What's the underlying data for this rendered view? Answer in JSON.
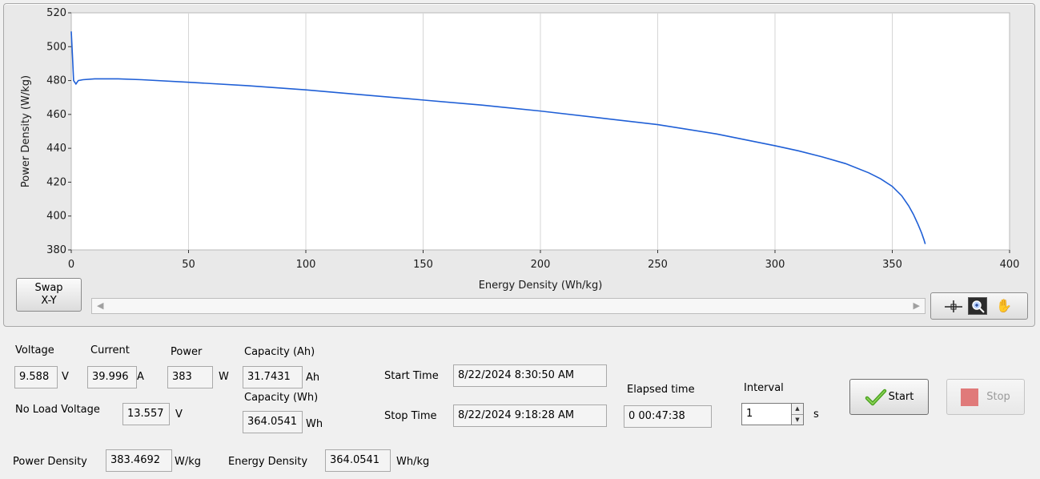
{
  "chart_data": {
    "type": "line",
    "xlabel": "Energy Density (Wh/kg)",
    "ylabel": "Power Density (W/kg)",
    "xlim": [
      0,
      400
    ],
    "ylim": [
      380,
      520
    ],
    "xticks": [
      0,
      50,
      100,
      150,
      200,
      250,
      300,
      350,
      400
    ],
    "yticks": [
      380,
      400,
      420,
      440,
      460,
      480,
      500,
      520
    ],
    "grid": "x-only",
    "line_color": "#1f5fd6",
    "series": [
      {
        "x": [
          0,
          0.5,
          1,
          2,
          3,
          5,
          10,
          20,
          30,
          50,
          75,
          100,
          125,
          150,
          175,
          200,
          225,
          250,
          275,
          300,
          310,
          320,
          330,
          340,
          345,
          350,
          354,
          357,
          359,
          361,
          362.5,
          363.5,
          364.05
        ],
        "y": [
          509,
          495,
          480,
          478,
          480,
          480.5,
          481,
          481,
          480.5,
          479,
          477,
          474.5,
          471.5,
          468.5,
          465.5,
          462,
          458,
          454,
          448.5,
          441.5,
          438.5,
          435,
          431,
          425.5,
          422,
          417.5,
          412,
          406,
          401,
          395,
          390,
          386,
          383.5
        ]
      }
    ]
  },
  "graph": {
    "swap_label_line1": "Swap",
    "swap_label_line2": "X-Y"
  },
  "readouts": {
    "voltage_label": "Voltage",
    "voltage_value": "9.588",
    "voltage_unit": "V",
    "current_label": "Current",
    "current_value": "39.996",
    "current_unit": "A",
    "power_label": "Power",
    "power_value": "383",
    "power_unit": "W",
    "capacity_ah_label": "Capacity (Ah)",
    "capacity_ah_value": "31.7431",
    "capacity_ah_unit": "Ah",
    "capacity_wh_label": "Capacity (Wh)",
    "capacity_wh_value": "364.0541",
    "capacity_wh_unit": "Wh",
    "noload_label": "No Load Voltage",
    "noload_value": "13.557",
    "noload_unit": "V",
    "power_density_label": "Power Density",
    "power_density_value": "383.4692",
    "power_density_unit": "W/kg",
    "energy_density_label": "Energy Density",
    "energy_density_value": "364.0541",
    "energy_density_unit": "Wh/kg"
  },
  "timing": {
    "start_label": "Start Time",
    "start_value": "8/22/2024 8:30:50 AM",
    "stop_label": "Stop Time",
    "stop_value": "8/22/2024 9:18:28 AM",
    "elapsed_label": "Elapsed time",
    "elapsed_value": "0 00:47:38",
    "interval_label": "Interval",
    "interval_value": "1",
    "interval_unit": "s"
  },
  "controls": {
    "start_label": "Start",
    "stop_label": "Stop",
    "start_icon": "checkmark-icon",
    "stop_icon": "stop-square-icon",
    "stop_color": "#e07a7a"
  }
}
